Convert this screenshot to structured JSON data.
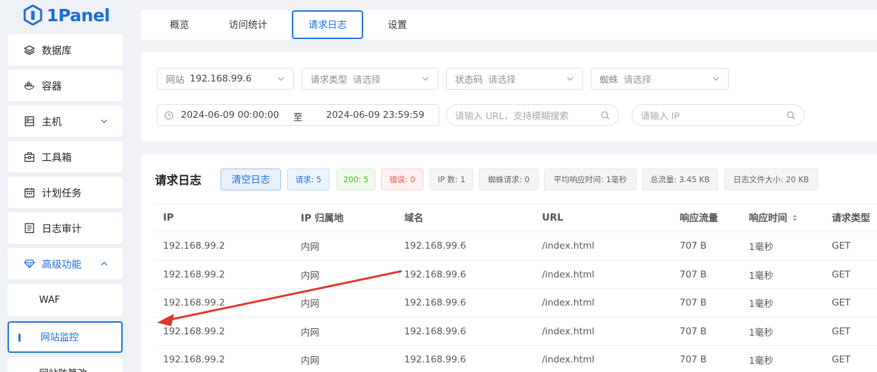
{
  "app": {
    "name": "1Panel",
    "brand_color": "#1a6ed8"
  },
  "sidebar": {
    "items": [
      {
        "label": "数据库",
        "icon": "layers-icon"
      },
      {
        "label": "容器",
        "icon": "docker-icon"
      },
      {
        "label": "主机",
        "icon": "server-icon"
      },
      {
        "label": "工具箱",
        "icon": "toolbox-icon"
      },
      {
        "label": "计划任务",
        "icon": "calendar-icon"
      },
      {
        "label": "日志审计",
        "icon": "log-icon"
      },
      {
        "label": "高级功能",
        "icon": "diamond-icon"
      }
    ],
    "sub_items": [
      {
        "label": "WAF"
      },
      {
        "label": "网站监控",
        "selected": true
      },
      {
        "label": "网站防篡改"
      }
    ]
  },
  "tabs": [
    {
      "label": "概览"
    },
    {
      "label": "访问统计"
    },
    {
      "label": "请求日志",
      "active": true
    },
    {
      "label": "设置"
    }
  ],
  "filters": {
    "site": {
      "label": "网站",
      "value": "192.168.99.6"
    },
    "request_type": {
      "label": "请求类型",
      "placeholder": "请选择"
    },
    "status_code": {
      "label": "状态码",
      "placeholder": "请选择"
    },
    "spider": {
      "label": "蜘蛛",
      "placeholder": "请选择"
    },
    "date_start": "2024-06-09 00:00:00",
    "date_sep": "至",
    "date_end": "2024-06-09 23:59:59",
    "url_placeholder": "请输入 URL，支持模糊搜索",
    "ip_placeholder": "请输入 IP"
  },
  "log": {
    "title": "请求日志",
    "clear_button": "清空日志",
    "badges": [
      {
        "text": "请求: 5",
        "style": "blue"
      },
      {
        "text": "200: 5",
        "style": "green"
      },
      {
        "text": "错误: 0",
        "style": "red"
      },
      {
        "text": "IP 数: 1",
        "style": "gray"
      },
      {
        "text": "蜘蛛请求: 0",
        "style": "gray"
      },
      {
        "text": "平均响应时间: 1毫秒",
        "style": "gray"
      },
      {
        "text": "总流量: 3.45 KB",
        "style": "gray"
      },
      {
        "text": "日志文件大小: 20 KB",
        "style": "gray"
      }
    ],
    "columns": [
      "IP",
      "IP 归属地",
      "域名",
      "URL",
      "响应流量",
      "响应时间",
      "请求类型"
    ],
    "rows": [
      [
        "192.168.99.2",
        "内网",
        "192.168.99.6",
        "/index.html",
        "707 B",
        "1毫秒",
        "GET"
      ],
      [
        "192.168.99.2",
        "内网",
        "192.168.99.6",
        "/index.html",
        "707 B",
        "1毫秒",
        "GET"
      ],
      [
        "192.168.99.2",
        "内网",
        "192.168.99.6",
        "/index.html",
        "707 B",
        "1毫秒",
        "GET"
      ],
      [
        "192.168.99.2",
        "内网",
        "192.168.99.6",
        "/index.html",
        "707 B",
        "1毫秒",
        "GET"
      ],
      [
        "192.168.99.2",
        "内网",
        "192.168.99.6",
        "/index.html",
        "707 B",
        "1毫秒",
        "GET"
      ]
    ]
  },
  "annotation": {
    "color": "#e2352b"
  }
}
